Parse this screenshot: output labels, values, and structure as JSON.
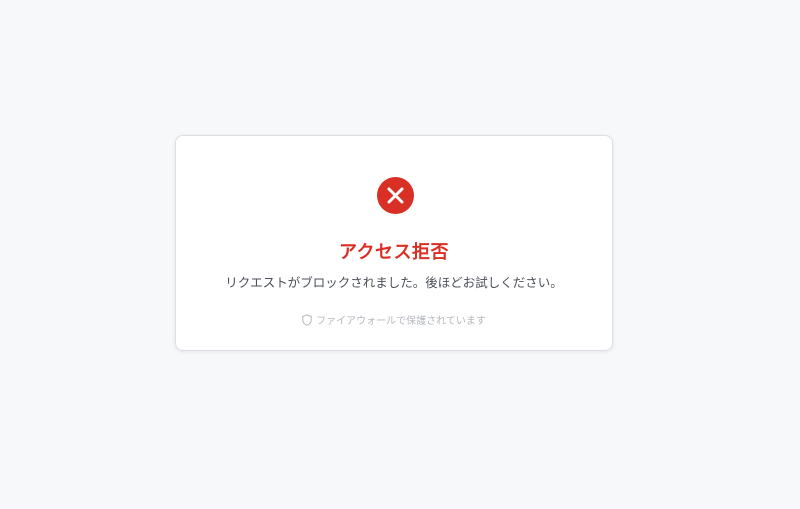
{
  "dialog": {
    "title": "アクセス拒否",
    "message": "リクエストがブロックされました。後ほどお試しください。",
    "footer_text": "ファイアウォールで保護されています",
    "status_icon": "error-x-circle-icon",
    "footer_icon": "shield-icon"
  },
  "colors": {
    "accent_red": "#d93025",
    "background": "#f7f8fa",
    "card": "#ffffff",
    "footer_text": "#b3b7bd"
  }
}
